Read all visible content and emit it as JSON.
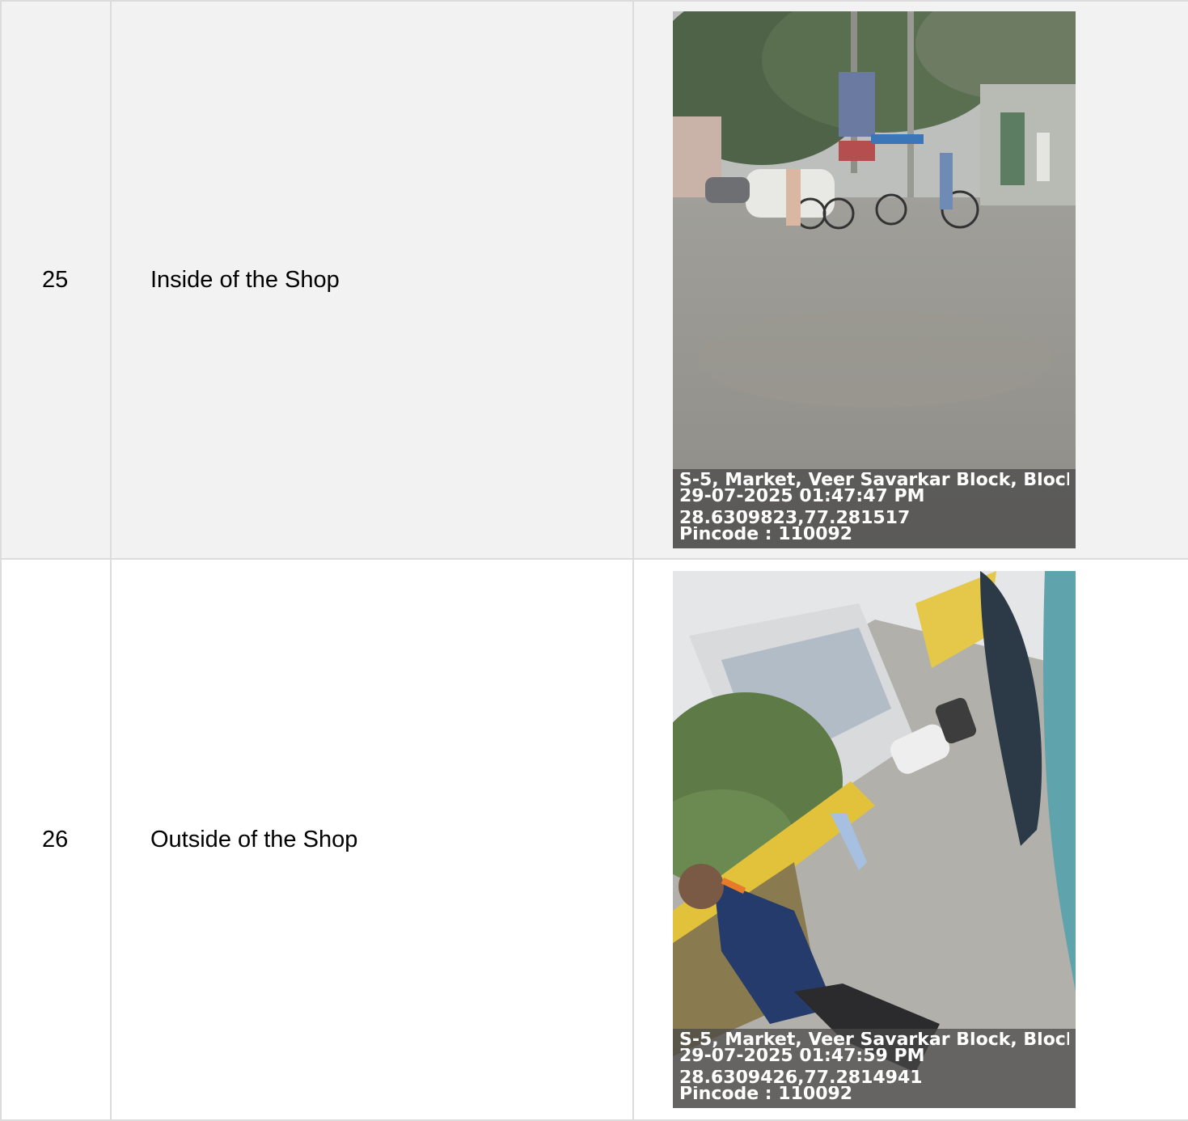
{
  "rows": [
    {
      "number": "25",
      "description": "Inside of the Shop",
      "photo": {
        "scene": "street-market-cycle-rickshaws",
        "stamp": {
          "address": "S-5, Market, Veer Savarkar Block, Block ...",
          "datetime": "29-07-2025 01:47:47 PM",
          "coordinates": "28.6309823,77.281517",
          "pincode": "Pincode : 110092"
        }
      }
    },
    {
      "number": "26",
      "description": "Outside of the Shop",
      "photo": {
        "scene": "tilted-street-with-person",
        "stamp": {
          "address": "S-5, Market, Veer Savarkar Block, Block ...",
          "datetime": "29-07-2025 01:47:59 PM",
          "coordinates": "28.6309426,77.2814941",
          "pincode": "Pincode : 110092"
        }
      }
    }
  ]
}
